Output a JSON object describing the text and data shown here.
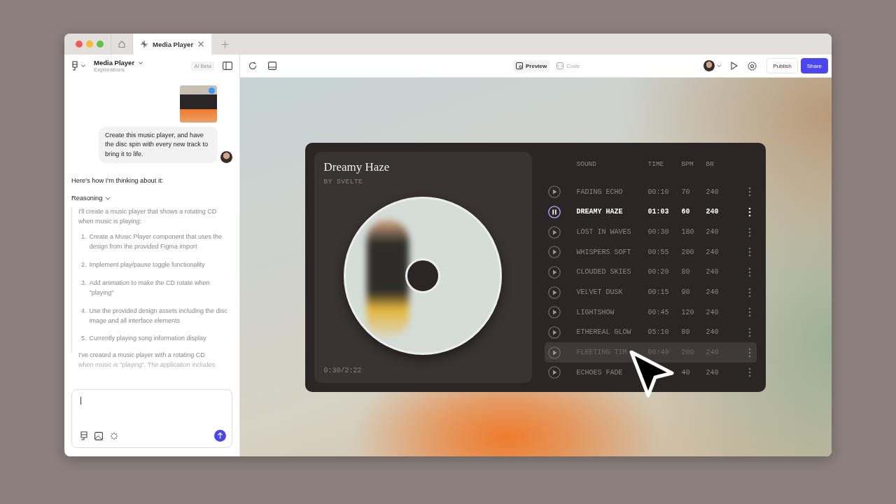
{
  "browser": {
    "tabs": [
      {
        "label": "Media Player",
        "selected": true
      }
    ]
  },
  "sidebar": {
    "project": "Media Player",
    "subtitle": "Explorations",
    "badge": "AI Beta",
    "user_message": "Create this music player, and have the disc spin with every new track to bring it to life.",
    "intro": "Here's how I'm thinking about it:",
    "reasoning": {
      "label": "Reasoning",
      "expanded": true,
      "lead": "I'll create a music player that shows a rotating CD when music is playing:",
      "steps": [
        {
          "number": "1.",
          "text": "Create a Music Player component that uses the design from the provided Figma import"
        },
        {
          "number": "2.",
          "text": "Implement play/pause toggle functionality"
        },
        {
          "number": "3.",
          "text": "Add animation to make the CD rotate when \"playing\""
        },
        {
          "number": "4.",
          "text": "Use the provided design assets including the disc image and all interface elements"
        },
        {
          "number": "5.",
          "text": "Currently playing song information display"
        }
      ]
    },
    "reply": [
      "I've created a music player with a rotating CD",
      "when music is \"playing\". The application includes"
    ]
  },
  "toolbar": {
    "view_tabs": [
      {
        "label": "Preview",
        "selected": true
      },
      {
        "label": "Code",
        "selected": false
      }
    ],
    "buttons": [
      {
        "label": "Publish",
        "kind": "secondary"
      },
      {
        "label": "Share",
        "kind": "primary"
      }
    ]
  },
  "player": {
    "title": "Dreamy Haze",
    "artist": "BY SVELTE",
    "time": "0:30/2:22",
    "columns": [
      "SOUND",
      "TIME",
      "BPM",
      "BR"
    ],
    "tracks": [
      {
        "sound": "FADING ECHO",
        "time": "00:10",
        "bpm": "70",
        "br": "240",
        "playing": false,
        "hovered": false
      },
      {
        "sound": "DREAMY HAZE",
        "time": "01:03",
        "bpm": "60",
        "br": "240",
        "playing": true,
        "hovered": false
      },
      {
        "sound": "LOST IN WAVES",
        "time": "00:30",
        "bpm": "180",
        "br": "240",
        "playing": false,
        "hovered": false
      },
      {
        "sound": "WHISPERS SOFT",
        "time": "00:55",
        "bpm": "200",
        "br": "240",
        "playing": false,
        "hovered": false
      },
      {
        "sound": "CLOUDED SKIES",
        "time": "00:20",
        "bpm": "80",
        "br": "240",
        "playing": false,
        "hovered": false
      },
      {
        "sound": "VELVET DUSK",
        "time": "00:15",
        "bpm": "90",
        "br": "240",
        "playing": false,
        "hovered": false
      },
      {
        "sound": "LIGHTSHOW",
        "time": "00:45",
        "bpm": "120",
        "br": "240",
        "playing": false,
        "hovered": false
      },
      {
        "sound": "ETHEREAL GLOW",
        "time": "05:10",
        "bpm": "80",
        "br": "240",
        "playing": false,
        "hovered": false
      },
      {
        "sound": "FLEETING TIM",
        "time": "00:40",
        "bpm": "200",
        "br": "240",
        "playing": false,
        "hovered": true
      },
      {
        "sound": "ECHOES FADE",
        "bpm": "40",
        "br": "240",
        "playing": false,
        "hovered": false
      }
    ]
  }
}
